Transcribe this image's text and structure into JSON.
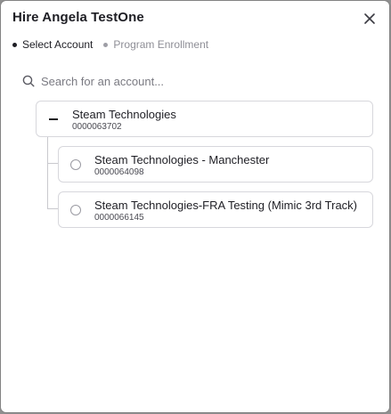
{
  "modal": {
    "title": "Hire Angela TestOne",
    "close_icon": "close-icon"
  },
  "steps": [
    {
      "label": "Select Account",
      "active": true
    },
    {
      "label": "Program Enrollment",
      "active": false
    }
  ],
  "search": {
    "placeholder": "Search for an account...",
    "value": "",
    "icon": "search-icon"
  },
  "accounts": {
    "parent": {
      "name": "Steam Technologies",
      "number": "0000063702",
      "expanded": true
    },
    "children": [
      {
        "name": "Steam Technologies - Manchester",
        "number": "0000064098",
        "selected": false
      },
      {
        "name": "Steam Technologies-FRA Testing (Mimic 3rd Track)",
        "number": "0000066145",
        "selected": false
      }
    ]
  },
  "colors": {
    "text": "#1e1e24",
    "muted": "#8e8e96",
    "border": "#d7d7dc",
    "backdrop": "#8f8f8f"
  }
}
